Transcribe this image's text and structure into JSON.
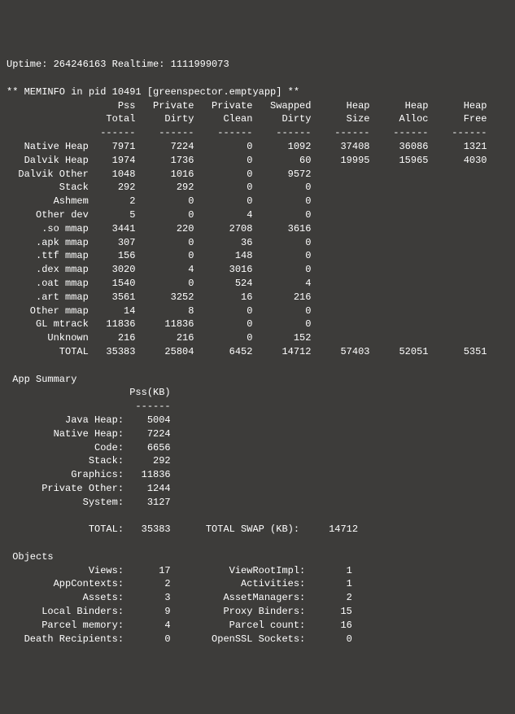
{
  "uptime_line": "Uptime: 264246163 Realtime: 1111999073",
  "meminfo_header": "** MEMINFO in pid 10491 [greenspector.emptyapp] **",
  "chart_data": {
    "type": "table",
    "title": "MEMINFO",
    "columns": [
      "",
      "Pss Total",
      "Private Dirty",
      "Private Clean",
      "Swapped Dirty",
      "Heap Size",
      "Heap Alloc",
      "Heap Free"
    ],
    "rows": [
      {
        "name": "Native Heap",
        "pss": 7971,
        "pdirty": 7224,
        "pclean": 0,
        "sdirty": 1092,
        "hsize": 37408,
        "halloc": 36086,
        "hfree": 1321
      },
      {
        "name": "Dalvik Heap",
        "pss": 1974,
        "pdirty": 1736,
        "pclean": 0,
        "sdirty": 60,
        "hsize": 19995,
        "halloc": 15965,
        "hfree": 4030
      },
      {
        "name": "Dalvik Other",
        "pss": 1048,
        "pdirty": 1016,
        "pclean": 0,
        "sdirty": 9572,
        "hsize": "",
        "halloc": "",
        "hfree": ""
      },
      {
        "name": "Stack",
        "pss": 292,
        "pdirty": 292,
        "pclean": 0,
        "sdirty": 0,
        "hsize": "",
        "halloc": "",
        "hfree": ""
      },
      {
        "name": "Ashmem",
        "pss": 2,
        "pdirty": 0,
        "pclean": 0,
        "sdirty": 0,
        "hsize": "",
        "halloc": "",
        "hfree": ""
      },
      {
        "name": "Other dev",
        "pss": 5,
        "pdirty": 0,
        "pclean": 4,
        "sdirty": 0,
        "hsize": "",
        "halloc": "",
        "hfree": ""
      },
      {
        "name": ".so mmap",
        "pss": 3441,
        "pdirty": 220,
        "pclean": 2708,
        "sdirty": 3616,
        "hsize": "",
        "halloc": "",
        "hfree": ""
      },
      {
        "name": ".apk mmap",
        "pss": 307,
        "pdirty": 0,
        "pclean": 36,
        "sdirty": 0,
        "hsize": "",
        "halloc": "",
        "hfree": ""
      },
      {
        "name": ".ttf mmap",
        "pss": 156,
        "pdirty": 0,
        "pclean": 148,
        "sdirty": 0,
        "hsize": "",
        "halloc": "",
        "hfree": ""
      },
      {
        "name": ".dex mmap",
        "pss": 3020,
        "pdirty": 4,
        "pclean": 3016,
        "sdirty": 0,
        "hsize": "",
        "halloc": "",
        "hfree": ""
      },
      {
        "name": ".oat mmap",
        "pss": 1540,
        "pdirty": 0,
        "pclean": 524,
        "sdirty": 4,
        "hsize": "",
        "halloc": "",
        "hfree": ""
      },
      {
        "name": ".art mmap",
        "pss": 3561,
        "pdirty": 3252,
        "pclean": 16,
        "sdirty": 216,
        "hsize": "",
        "halloc": "",
        "hfree": ""
      },
      {
        "name": "Other mmap",
        "pss": 14,
        "pdirty": 8,
        "pclean": 0,
        "sdirty": 0,
        "hsize": "",
        "halloc": "",
        "hfree": ""
      },
      {
        "name": "GL mtrack",
        "pss": 11836,
        "pdirty": 11836,
        "pclean": 0,
        "sdirty": 0,
        "hsize": "",
        "halloc": "",
        "hfree": ""
      },
      {
        "name": "Unknown",
        "pss": 216,
        "pdirty": 216,
        "pclean": 0,
        "sdirty": 152,
        "hsize": "",
        "halloc": "",
        "hfree": ""
      }
    ],
    "total": {
      "name": "TOTAL",
      "pss": 35383,
      "pdirty": 25804,
      "pclean": 6452,
      "sdirty": 14712,
      "hsize": 57403,
      "halloc": 52051,
      "hfree": 5351
    }
  },
  "app_summary": {
    "title": " App Summary",
    "col_label": "Pss(KB)",
    "rows": [
      {
        "name": "Java Heap:",
        "val": 5004
      },
      {
        "name": "Native Heap:",
        "val": 7224
      },
      {
        "name": "Code:",
        "val": 6656
      },
      {
        "name": "Stack:",
        "val": 292
      },
      {
        "name": "Graphics:",
        "val": 11836
      },
      {
        "name": "Private Other:",
        "val": 1244
      },
      {
        "name": "System:",
        "val": 3127
      }
    ],
    "total_label": "TOTAL:",
    "total_val": 35383,
    "swap_label": "TOTAL SWAP (KB):",
    "swap_val": 14712
  },
  "objects": {
    "title": " Objects",
    "rows": [
      {
        "l": "Views:",
        "lv": 17,
        "r": "ViewRootImpl:",
        "rv": 1
      },
      {
        "l": "AppContexts:",
        "lv": 2,
        "r": "Activities:",
        "rv": 1
      },
      {
        "l": "Assets:",
        "lv": 3,
        "r": "AssetManagers:",
        "rv": 2
      },
      {
        "l": "Local Binders:",
        "lv": 9,
        "r": "Proxy Binders:",
        "rv": 15
      },
      {
        "l": "Parcel memory:",
        "lv": 4,
        "r": "Parcel count:",
        "rv": 16
      },
      {
        "l": "Death Recipients:",
        "lv": 0,
        "r": "OpenSSL Sockets:",
        "rv": 0
      }
    ]
  }
}
